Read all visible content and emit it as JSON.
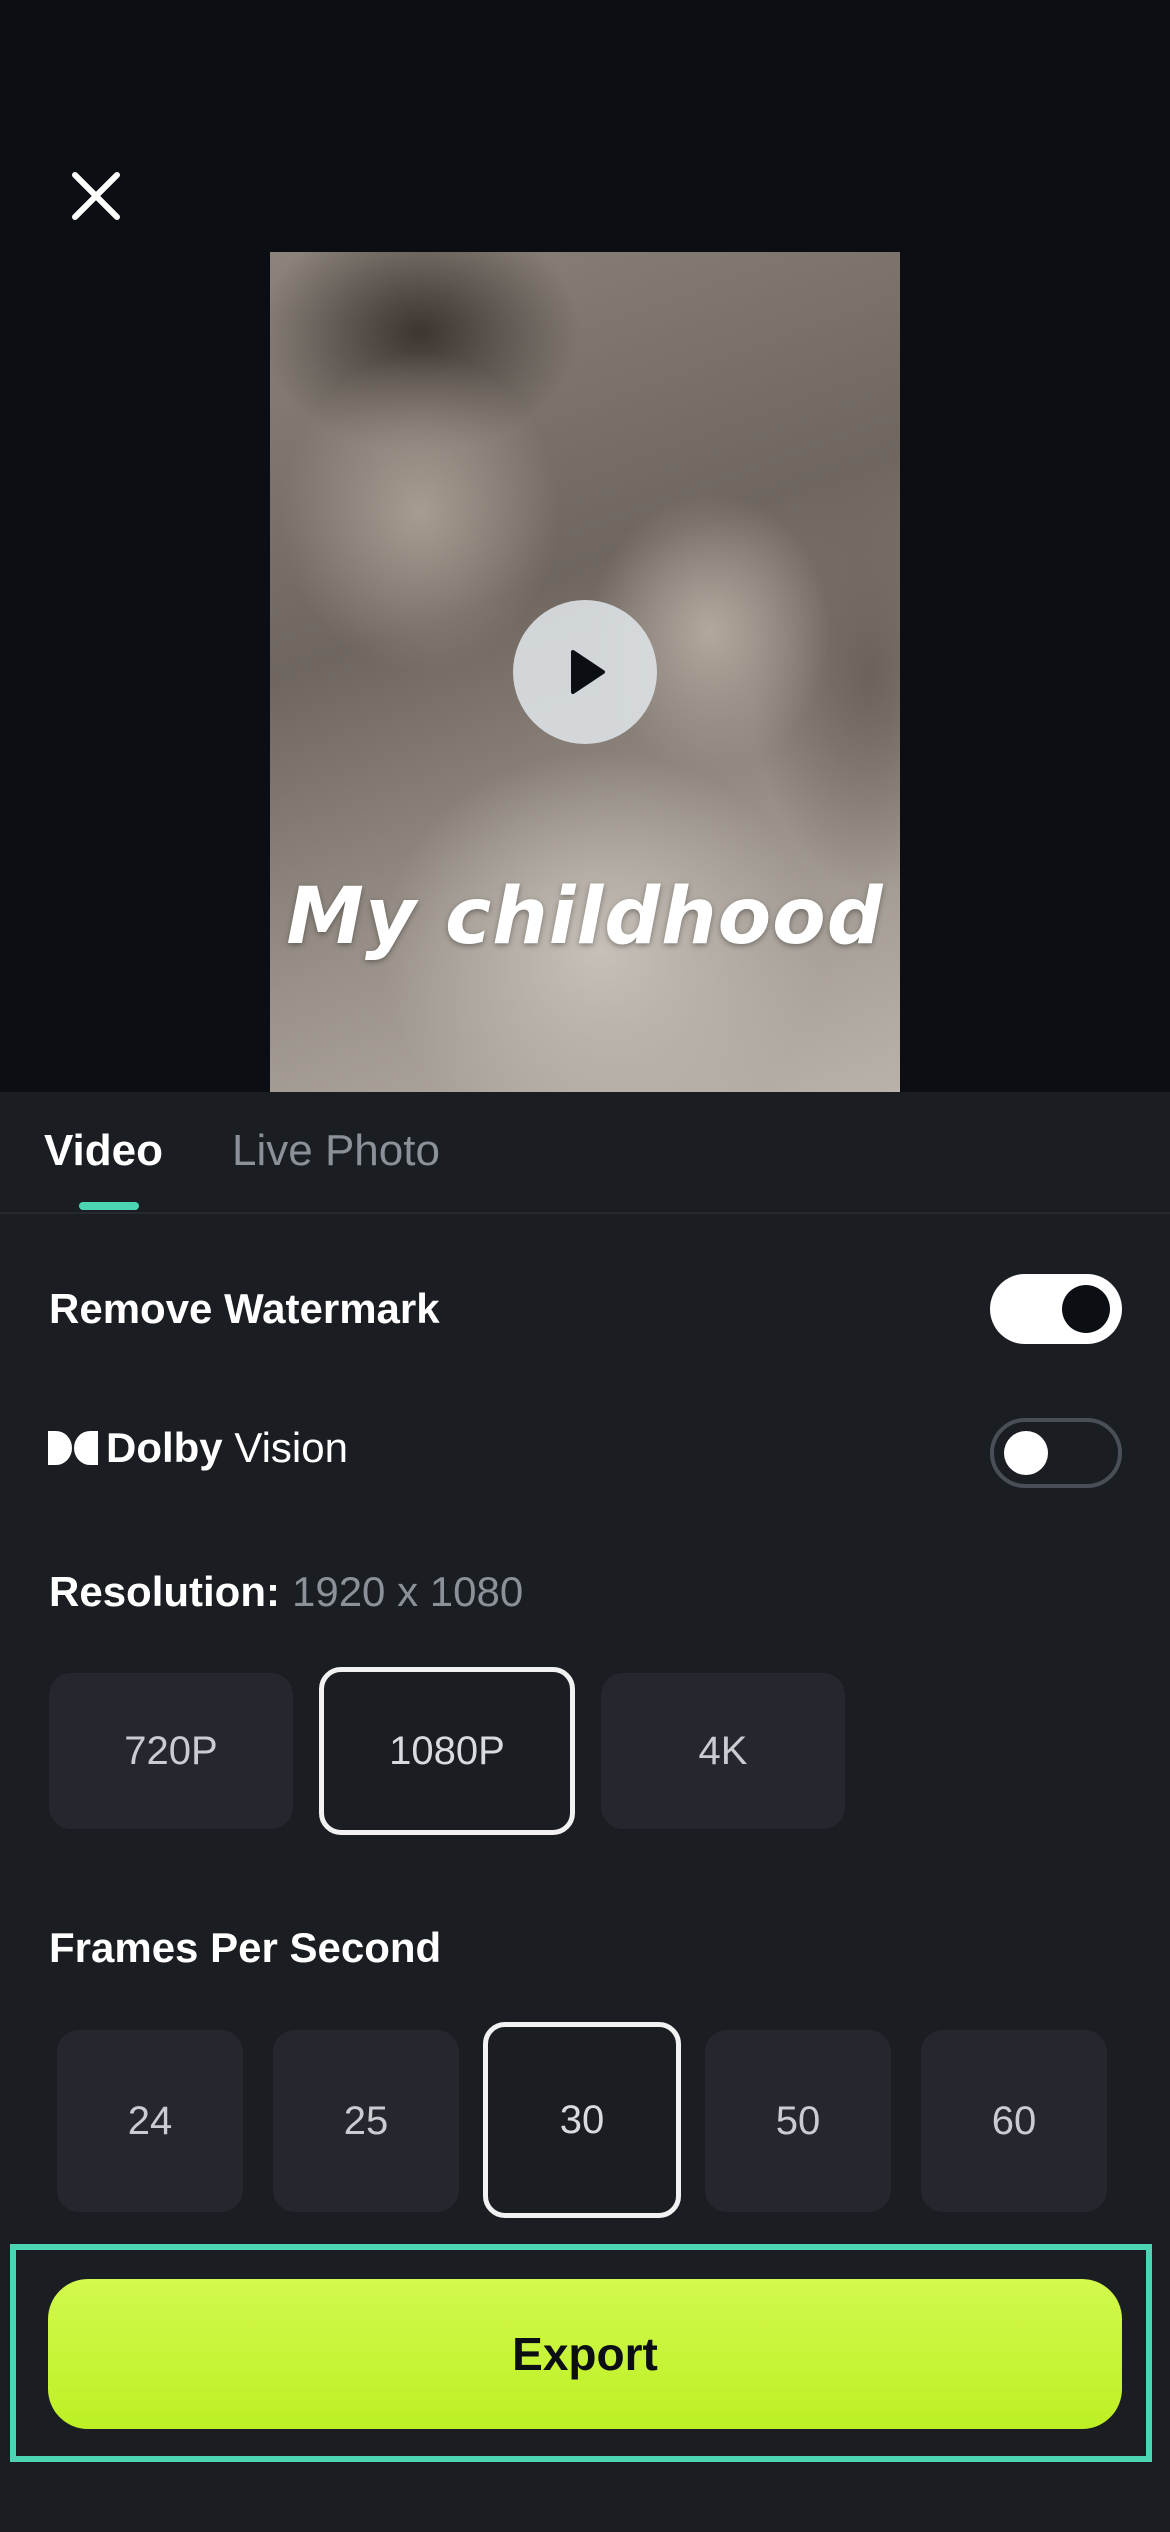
{
  "preview": {
    "title_text": "My childhood"
  },
  "tabs": [
    {
      "label": "Video",
      "active": true
    },
    {
      "label": "Live Photo",
      "active": false
    }
  ],
  "watermark": {
    "label": "Remove Watermark",
    "enabled": true
  },
  "dolby": {
    "brand": "Dolby",
    "product": "Vision",
    "enabled": false
  },
  "resolution": {
    "label": "Resolution:",
    "value": "1920 x 1080",
    "options": [
      "720P",
      "1080P",
      "4K"
    ],
    "selected": "1080P"
  },
  "fps": {
    "label": "Frames Per Second",
    "options": [
      "24",
      "25",
      "30",
      "50",
      "60"
    ],
    "selected": "30"
  },
  "export": {
    "label": "Export"
  },
  "colors": {
    "accent": "#4cd5b4",
    "export_button": "#c8f53a",
    "sheet_background": "#1a1d22",
    "top_background": "#0b0e12"
  }
}
